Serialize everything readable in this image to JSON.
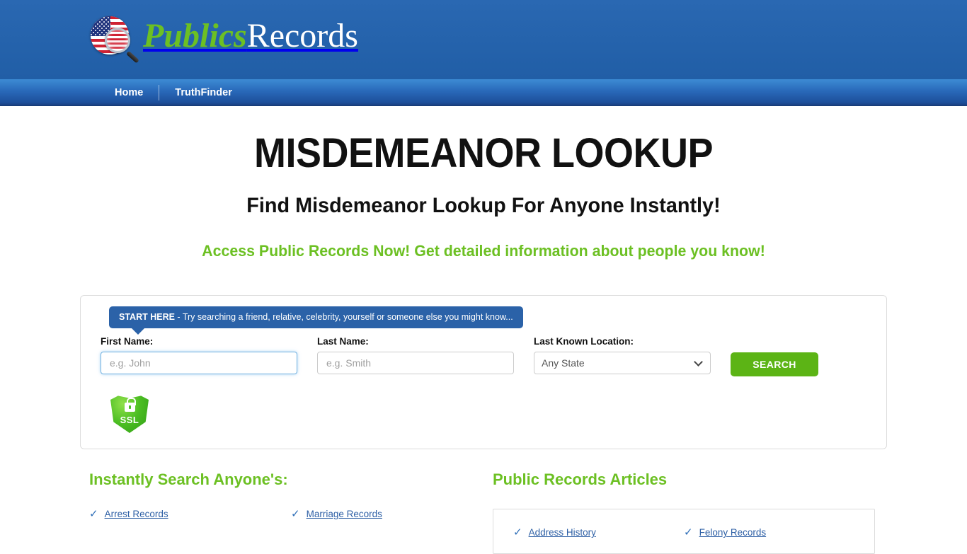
{
  "header": {
    "logo": {
      "icon": "us-flag-magnifier-icon",
      "text_green": "Publics",
      "text_white": "Records"
    }
  },
  "nav": {
    "items": [
      {
        "label": "Home"
      },
      {
        "label": "TruthFinder"
      }
    ]
  },
  "hero": {
    "title": "MISDEMEANOR LOOKUP",
    "subtitle": "Find Misdemeanor Lookup For Anyone Instantly!",
    "tagline": "Access Public Records Now! Get detailed information about people you know!"
  },
  "search": {
    "callout_bold": "START HERE",
    "callout_rest": " - Try searching a friend, relative, celebrity, yourself or someone else you might know...",
    "first_name_label": "First Name:",
    "first_name_placeholder": "e.g. John",
    "first_name_value": "",
    "last_name_label": "Last Name:",
    "last_name_placeholder": "e.g. Smith",
    "last_name_value": "",
    "location_label": "Last Known Location:",
    "location_selected": "Any State",
    "location_options": [
      "Any State"
    ],
    "search_button": "SEARCH",
    "ssl_badge_text": "SSL",
    "ssl_icon": "padlock-shield-icon"
  },
  "instant_search": {
    "heading": "Instantly Search Anyone's:",
    "links": [
      "Arrest Records",
      "Marriage Records"
    ]
  },
  "articles": {
    "heading": "Public Records Articles",
    "links": [
      "Address History",
      "Felony Records"
    ]
  },
  "colors": {
    "header_blue": "#2463ad",
    "nav_blue_top": "#3d8bd4",
    "nav_blue_bottom": "#1a3f80",
    "accent_green": "#6cc023",
    "button_green": "#5cb415",
    "link_blue": "#2d5fa5",
    "callout_blue": "#2b62a8"
  }
}
